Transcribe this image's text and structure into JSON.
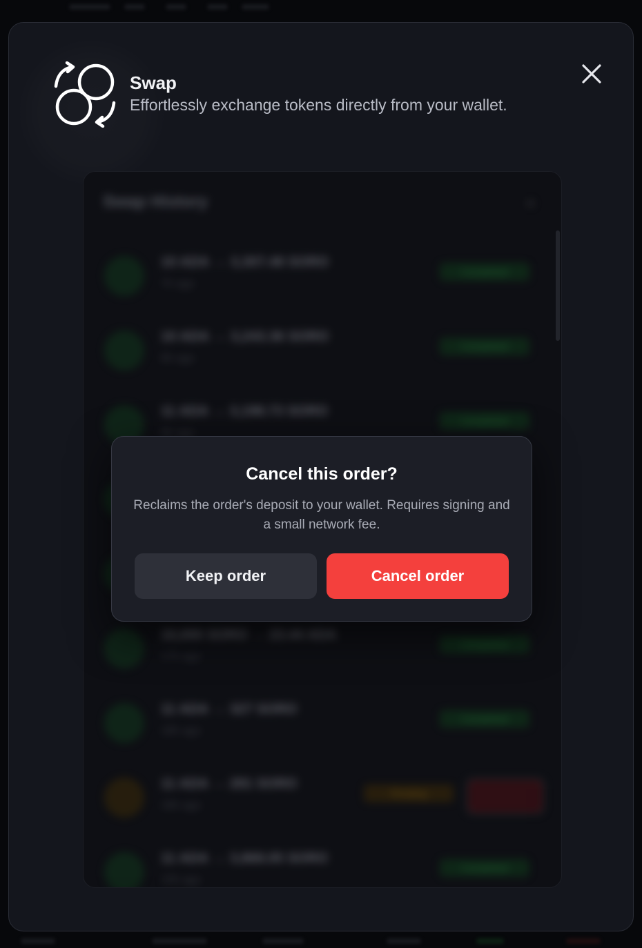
{
  "header": {
    "title": "Swap",
    "subtitle": "Effortlessly exchange tokens directly from your wallet."
  },
  "history": {
    "title": "Swap History",
    "rows": [
      {
        "pair": "10 ADA → 3,307.48 SORO",
        "time": "7h ago",
        "status": "Completed",
        "pending": false
      },
      {
        "pair": "10 ADA → 3,243.36 SORO",
        "time": "8h ago",
        "status": "Completed",
        "pending": false
      },
      {
        "pair": "11 ADA → 3,198.73 SORO",
        "time": "9h ago",
        "status": "Completed",
        "pending": false
      },
      {
        "pair": "",
        "time": "",
        "status": "",
        "pending": false
      },
      {
        "pair": "",
        "time": "",
        "status": "",
        "pending": false
      },
      {
        "pair": "10,000 SORO → 23.44 ADA",
        "time": "17h ago",
        "status": "Completed",
        "pending": false
      },
      {
        "pair": "11 ADA → 327 SORO",
        "time": "18h ago",
        "status": "Completed",
        "pending": false
      },
      {
        "pair": "11 ADA → 281 SORO",
        "time": "18h ago",
        "status": "Pending",
        "pending": true,
        "cancel": "Cancel"
      },
      {
        "pair": "11 ADA → 3,868.05 SORO",
        "time": "19h ago",
        "status": "Completed",
        "pending": false
      }
    ]
  },
  "dialog": {
    "title": "Cancel this order?",
    "message": "Reclaims the order's deposit to your wallet. Requires signing and a small network fee.",
    "keep_label": "Keep order",
    "cancel_label": "Cancel order"
  },
  "colors": {
    "danger": "#f4403d",
    "success": "#2e9b48",
    "warning": "#a8780f"
  }
}
